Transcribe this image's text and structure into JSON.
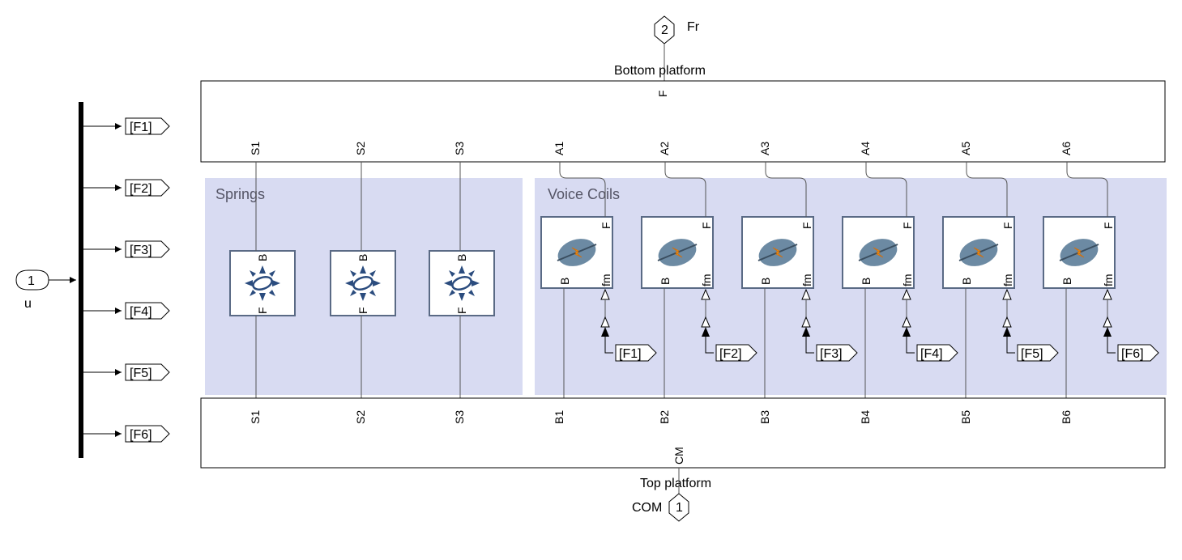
{
  "input": {
    "port_number": "1",
    "label": "u"
  },
  "outputs": {
    "port2": {
      "number": "2",
      "label": "Fr"
    },
    "port1": {
      "number": "1",
      "label_prefix": "COM"
    }
  },
  "demux_tags": [
    "[F1]",
    "[F2]",
    "[F3]",
    "[F4]",
    "[F5]",
    "[F6]"
  ],
  "bottom_platform": {
    "title": "Bottom platform",
    "center_port": "F",
    "ports": [
      "S1",
      "S2",
      "S3",
      "A1",
      "A2",
      "A3",
      "A4",
      "A5",
      "A6"
    ]
  },
  "top_platform": {
    "title": "Top platform",
    "center_port": "CM",
    "ports": [
      "S1",
      "S2",
      "S3",
      "B1",
      "B2",
      "B3",
      "B4",
      "B5",
      "B6"
    ]
  },
  "groups": {
    "springs": {
      "title": "Springs",
      "port_B": "B",
      "port_F": "F"
    },
    "voice_coils": {
      "title": "Voice Coils",
      "port_B": "B",
      "port_F": "F",
      "port_fm": "fm",
      "from_tags": [
        "[F1]",
        "[F2]",
        "[F3]",
        "[F4]",
        "[F5]",
        "[F6]"
      ]
    }
  }
}
